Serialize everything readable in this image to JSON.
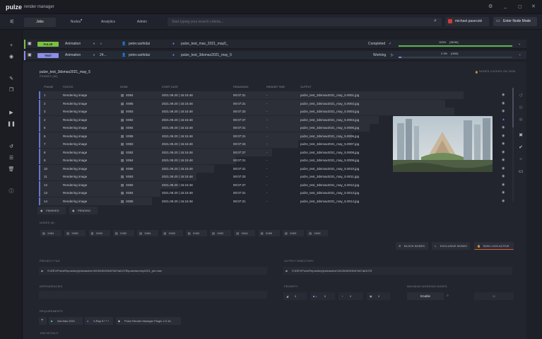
{
  "app": {
    "logo": "pulze",
    "title": "render manager"
  },
  "window_controls": [
    "gear-icon",
    "minimize-icon",
    "restore-icon",
    "close-icon"
  ],
  "tabs": [
    {
      "label": "Jobs",
      "active": true
    },
    {
      "label": "Nodes",
      "active": false,
      "badge": "●"
    },
    {
      "label": "Analytics",
      "active": false
    },
    {
      "label": "Admin",
      "active": false
    }
  ],
  "search": {
    "placeholder": "Start typing your search criteria..."
  },
  "user": {
    "name": "michael.pasecski"
  },
  "enter_node_mode": "Enter Node Mode",
  "jobs": [
    {
      "tag": "PULZE",
      "tag_color": "#7bc043",
      "type": "Animation",
      "owner": "peter.sarhidai",
      "scene": "pulze_test_max_2021_may5_",
      "status": "Completed",
      "progress": "100%",
      "progress_detail": "(36/36)",
      "progress_value": 1.0,
      "bar_color": "#5bb64a"
    },
    {
      "tag": "TEST",
      "tag_color": "#8c8fe6",
      "type": "Animation",
      "owner": "peter.sarhidai",
      "scene": "pulze_test_3dsmax2021_may_5",
      "status": "Working",
      "progress": "2.3%",
      "progress_detail": "(0/60)",
      "progress_value": 0.023,
      "bar_color": "#7f84e0"
    }
  ],
  "job2_frames_label": "24...",
  "detail": {
    "title": "pulze_test_3dsmax2021_may_5",
    "subtitle": "FRAMES (60)",
    "locked_label": "NODES LOCKED ON TASK",
    "columns": [
      "FRAME",
      "STATUS",
      "NODE",
      "START DATE",
      "REMAINING",
      "RENDER TIME",
      "OUTPUT"
    ],
    "rows": [
      {
        "frame": "1",
        "status": "Rendering image",
        "node": "X084",
        "start": "2021.09.20 | 15:15:48",
        "remaining": "00:07:31",
        "render": "-",
        "output": "pulze_test_3dsmax2021_may_5.0001.jpg",
        "progress": 0.95
      },
      {
        "frame": "2",
        "status": "Rendering image",
        "node": "X085",
        "start": "2021.09.20 | 15:15:48",
        "remaining": "00:07:31",
        "render": "-",
        "output": "pulze_test_3dsmax2021_may_5.0002.jpg",
        "progress": 0.91
      },
      {
        "frame": "3",
        "status": "Rendering image",
        "node": "X083",
        "start": "2021.09.20 | 15:15:48",
        "remaining": "00:07:33",
        "render": "-",
        "output": "pulze_test_3dsmax2021_may_5.0003.jpg",
        "progress": 0.93
      },
      {
        "frame": "4",
        "status": "Rendering image",
        "node": "X082",
        "start": "2021.09.20 | 15:15:48",
        "remaining": "00:07:37",
        "render": "-",
        "output": "pulze_test_3dsmax2021_may_5.0004.jpg",
        "progress": 0.76
      },
      {
        "frame": "5",
        "status": "Rendering image",
        "node": "X084",
        "start": "2021.09.20 | 15:15:48",
        "remaining": "00:07:31",
        "render": "-",
        "output": "pulze_test_3dsmax2021_may_5.0005.jpg",
        "progress": 0.74
      },
      {
        "frame": "6",
        "status": "Rendering image",
        "node": "X085",
        "start": "2021.09.20 | 15:15:48",
        "remaining": "00:07:31",
        "render": "-",
        "output": "pulze_test_3dsmax2021_may_5.0006.jpg",
        "progress": 0.7
      },
      {
        "frame": "7",
        "status": "Rendering image",
        "node": "X083",
        "start": "2021.09.20 | 15:15:48",
        "remaining": "00:07:33",
        "render": "-",
        "output": "pulze_test_3dsmax2021_may_5.0007.jpg",
        "progress": 0.58
      },
      {
        "frame": "8",
        "status": "Rendering image",
        "node": "X082",
        "start": "2021.09.20 | 15:15:48",
        "remaining": "00:07:37",
        "render": "-",
        "output": "pulze_test_3dsmax2021_may_5.0008.jpg",
        "progress": 0.52
      },
      {
        "frame": "9",
        "status": "Rendering image",
        "node": "X084",
        "start": "2021.09.20 | 15:15:48",
        "remaining": "00:07:31",
        "render": "-",
        "output": "pulze_test_3dsmax2021_may_5.0009.jpg",
        "progress": 0.44
      },
      {
        "frame": "10",
        "status": "Rendering image",
        "node": "X085",
        "start": "2021.09.20 | 15:15:48",
        "remaining": "00:07:31",
        "render": "-",
        "output": "pulze_test_3dsmax2021_may_5.0010.jpg",
        "progress": 0.39
      },
      {
        "frame": "11",
        "status": "Rendering image",
        "node": "X083",
        "start": "2021.09.20 | 15:15:48",
        "remaining": "00:07:33",
        "render": "-",
        "output": "pulze_test_3dsmax2021_may_5.0011.jpg",
        "progress": 0.35
      },
      {
        "frame": "12",
        "status": "Rendering image",
        "node": "X082",
        "start": "2021.09.20 | 15:15:48",
        "remaining": "00:07:37",
        "render": "-",
        "output": "pulze_test_3dsmax2021_may_5.0012.jpg",
        "progress": 0.31
      },
      {
        "frame": "13",
        "status": "Rendering image",
        "node": "X084",
        "start": "2021.09.20 | 15:15:48",
        "remaining": "00:07:31",
        "render": "-",
        "output": "pulze_test_3dsmax2021_may_5.0013.jpg",
        "progress": 0.27
      },
      {
        "frame": "14",
        "status": "Rendering image",
        "node": "X085",
        "start": "2021.09.20 | 15:15:48",
        "remaining": "00:07:31",
        "render": "-",
        "output": "pulze_test_3dsmax2021_may_5.0014.jpg",
        "progress": 0.25
      }
    ],
    "filters": {
      "finished": "FINISHED",
      "pending": "PENDING"
    },
    "nodes_label": "NODES (8)",
    "nodes": [
      "X084",
      "X085",
      "X083",
      "X082",
      "X084",
      "X085",
      "X083",
      "X082",
      "X084",
      "X085",
      "X083",
      "X082"
    ],
    "actions": {
      "block": "BLOCK NODES",
      "exclusive": "EXCLUSIVE NODES",
      "lock": "TASK LOCK ACTIVE"
    },
    "project_file_label": "PROJECT FILE",
    "project_file": "S:\\DEV\\PulzeRepository\\jobs\\active\\J6139d5193b57d67a61078\\pulzedummy2021_job.max",
    "output_dir_label": "OUTPUT DIRECTORY",
    "output_dir": "S:\\DEV\\PulzeRepository\\jobs\\active\\J6139d5193b57d67a61078",
    "dependencies_label": "DEPENDENCIES",
    "priority_label": "PRIORITY",
    "priority_values": [
      "0",
      "0",
      "0",
      "0"
    ],
    "max_nodes_label": "MAXIMUM WORKING NODES",
    "enable_label": "Enable",
    "max_nodes_value": "50",
    "requirements_label": "REQUIREMENTS",
    "requirements": [
      "3ds Max 2021",
      "V-Ray 5.*.*.*",
      "Pulze Render Manager Plugin 2.0.16"
    ],
    "job_details_label": "JOB DETAILS"
  }
}
